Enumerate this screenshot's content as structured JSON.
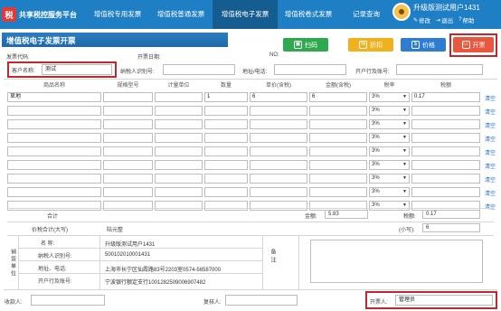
{
  "header": {
    "logo_text": "共享税控服务平台",
    "nav": [
      "增值税专用发票",
      "增值税普通发票",
      "增值税电子发票",
      "增值税卷式发票",
      "记录查询"
    ],
    "user_name": "升级版测试用户1431",
    "links": {
      "edit": "修改",
      "logout": "退出",
      "help": "帮助"
    }
  },
  "page": {
    "title": "增值税电子发票开票"
  },
  "toolbar": {
    "scan": "扫码",
    "discount": "折扣",
    "price": "价格",
    "issue": "开票"
  },
  "invoice_info": {
    "code_label": "发票代码:",
    "date_label": "开票日期:",
    "no_label": "NO:",
    "customer_label": "客户名称:",
    "customer_value": "测试",
    "taxid_label": "纳税人识别号:",
    "address_label": "地址/电话:",
    "bank_label": "开户行及账号:"
  },
  "items_table": {
    "headers": [
      "商品名称",
      "规格型号",
      "计量单位",
      "数量",
      "单价(含税)",
      "金额(含税)",
      "税率",
      "税额"
    ],
    "clear_label": "清空",
    "rows": [
      {
        "name": "草地",
        "spec": "",
        "unit": "",
        "qty": "1",
        "price": "6",
        "amount": "6",
        "rate": "3%",
        "tax": "0.17"
      },
      {
        "name": "",
        "spec": "",
        "unit": "",
        "qty": "",
        "price": "",
        "amount": "",
        "rate": "3%",
        "tax": ""
      },
      {
        "name": "",
        "spec": "",
        "unit": "",
        "qty": "",
        "price": "",
        "amount": "",
        "rate": "3%",
        "tax": ""
      },
      {
        "name": "",
        "spec": "",
        "unit": "",
        "qty": "",
        "price": "",
        "amount": "",
        "rate": "3%",
        "tax": ""
      },
      {
        "name": "",
        "spec": "",
        "unit": "",
        "qty": "",
        "price": "",
        "amount": "",
        "rate": "3%",
        "tax": ""
      },
      {
        "name": "",
        "spec": "",
        "unit": "",
        "qty": "",
        "price": "",
        "amount": "",
        "rate": "3%",
        "tax": ""
      },
      {
        "name": "",
        "spec": "",
        "unit": "",
        "qty": "",
        "price": "",
        "amount": "",
        "rate": "3%",
        "tax": ""
      },
      {
        "name": "",
        "spec": "",
        "unit": "",
        "qty": "",
        "price": "",
        "amount": "",
        "rate": "3%",
        "tax": ""
      },
      {
        "name": "",
        "spec": "",
        "unit": "",
        "qty": "",
        "price": "",
        "amount": "",
        "rate": "3%",
        "tax": ""
      }
    ]
  },
  "totals": {
    "total_label": "合计",
    "amount_label": "金额:",
    "amount_value": "5.83",
    "tax_label": "税额:",
    "tax_value": "0.17",
    "grand_label": "价税合计(大写)",
    "grand_value": "陆元整",
    "small_label": "(小写):",
    "small_value": "6"
  },
  "seller": {
    "section_label": "销货单位",
    "name_label": "名 称:",
    "name_value": "升级版测试用户1431",
    "taxid_label": "纳税人识别号:",
    "taxid_value": "500102010001431",
    "address_label": "地址、电话:",
    "address_value": "上海市长宁区仙霞路83号2203室0574-56587000",
    "bank_label": "开户行及账号:",
    "bank_value": "宁波银行额定支行1001282509006907482"
  },
  "remark": {
    "label": "备注"
  },
  "footer": {
    "payee_label": "收款人:",
    "reviewer_label": "复核人:",
    "drawer_label": "开票人:",
    "drawer_value": "管理员"
  },
  "colors": {
    "nav_bg": "#1f7fc4",
    "nav_active": "#155d91",
    "scan": "#2fa84f",
    "discount": "#f0b21c",
    "price": "#2f7dd1",
    "issue": "#e9573f",
    "highlight": "#c0282d"
  }
}
